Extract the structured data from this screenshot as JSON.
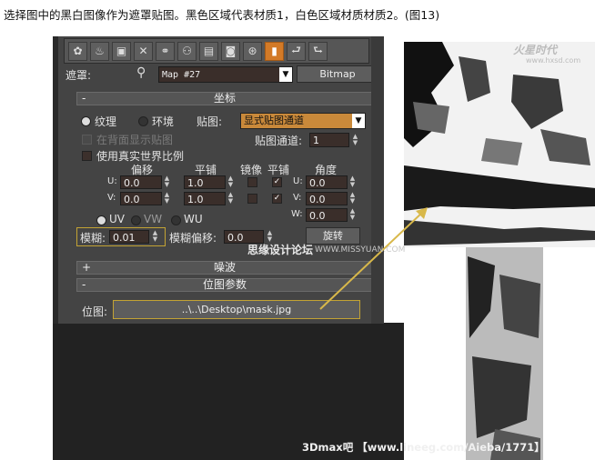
{
  "caption": "选择图中的黑白图像作为遮罩贴图。黑色区域代表材质1，白色区域材质材质2。(图13)",
  "toolbar": {
    "icons": [
      "teapot-icon",
      "eyedropper-icon",
      "material-icon",
      "delete-icon",
      "link-icon",
      "put-to-library-icon",
      "map-channel-icon",
      "show-map-icon",
      "background-icon",
      "show-end-result-icon",
      "go-to-parent-icon",
      "go-forward-icon"
    ],
    "glyphs": [
      "✿",
      "♨",
      "▣",
      "✕",
      "⚭",
      "⚇",
      "▤",
      "◙",
      "⊛",
      "▮",
      "⮐",
      "⮑"
    ]
  },
  "header": {
    "mask_label": "遮罩:",
    "map_name": "Map #27",
    "map_type": "Bitmap"
  },
  "coords": {
    "title": "坐标",
    "sign": "-",
    "texture_label": "纹理",
    "environ_label": "环境",
    "mapping_label": "贴图:",
    "mapping_value": "显式贴图通道",
    "show_back_label": "在背面显示贴图",
    "channel_label": "贴图通道:",
    "channel_value": "1",
    "real_world_label": "使用真实世界比例",
    "offset_label": "偏移",
    "tiling_label": "平铺",
    "mirror_label": "镜像",
    "tile_label": "平铺",
    "angle_label": "角度",
    "u_label": "U:",
    "v_label": "V:",
    "w_label": "W:",
    "u_offset": "0.0",
    "v_offset": "0.0",
    "u_tiling": "1.0",
    "v_tiling": "1.0",
    "u_angle": "0.0",
    "v_angle": "0.0",
    "w_angle": "0.0",
    "uv_label": "UV",
    "vw_label": "VW",
    "wu_label": "WU",
    "blur_label": "模糊:",
    "blur_value": "0.01",
    "blur_offset_label": "模糊偏移:",
    "blur_offset_value": "0.0",
    "rotate_label": "旋转"
  },
  "noise": {
    "title": "噪波",
    "sign": "+"
  },
  "bitmap_params": {
    "title": "位图参数",
    "sign": "-",
    "bitmap_label": "位图:",
    "bitmap_path": "..\\..\\Desktop\\mask.jpg"
  },
  "watermarks": {
    "forum": "思缘设计论坛",
    "forum_url": "WWW.MISSYUAN.COM",
    "logo": "火星时代",
    "logo_url": "www.hxsd.com",
    "footer": "3Dmax吧 【www.lineeg.com/Aieba/1771】"
  },
  "colors": {
    "accent": "#d37a27",
    "highlight": "#c3a334",
    "arrow": "#d8b84a"
  }
}
